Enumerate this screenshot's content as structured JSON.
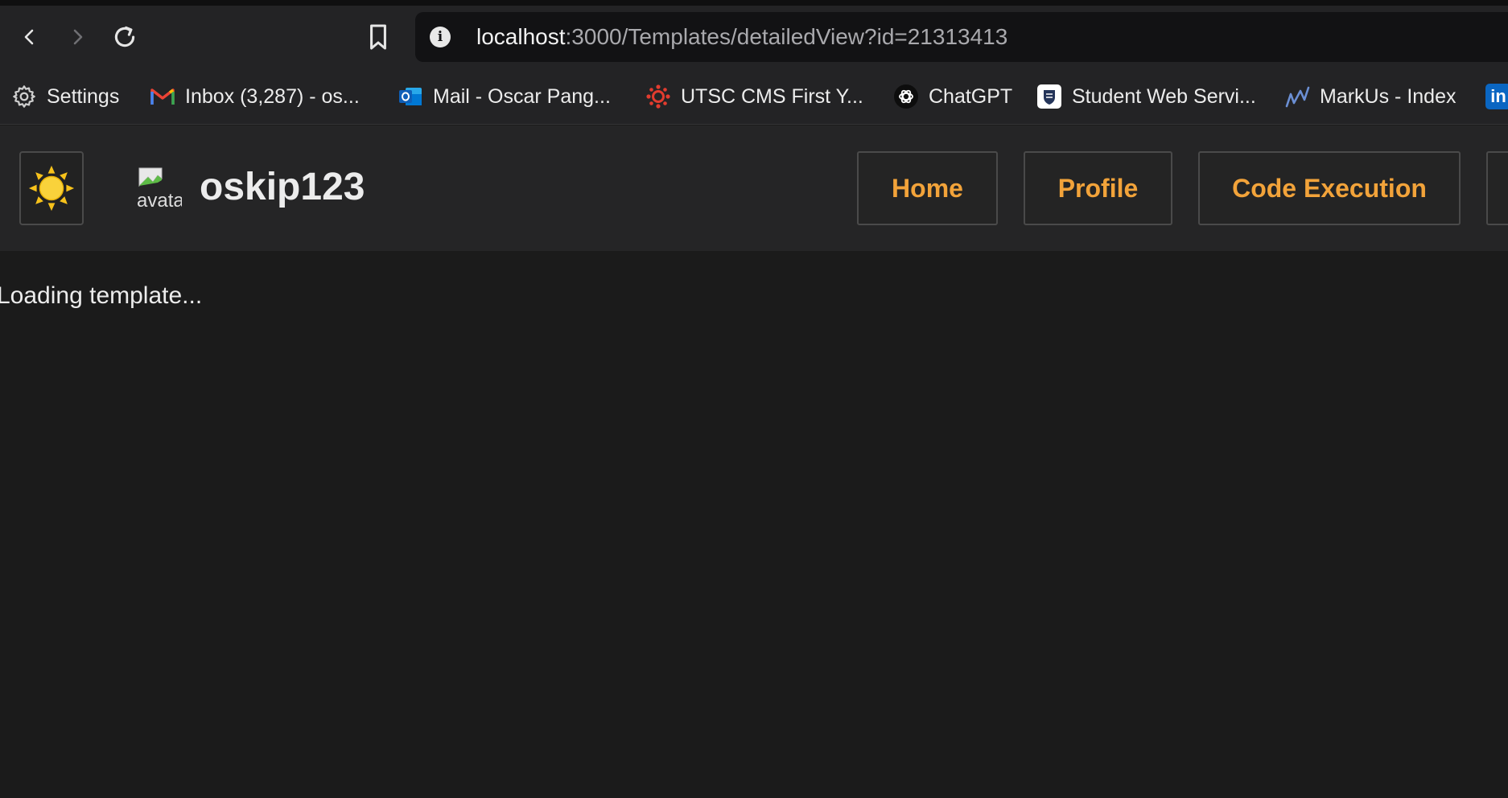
{
  "browser": {
    "url_host": "localhost",
    "url_path": ":3000/Templates/detailedView?id=21313413",
    "nav_icons": [
      "back-arrow-icon",
      "forward-arrow-icon",
      "reload-icon",
      "bookmark-icon",
      "info-icon"
    ],
    "bookmarks": [
      {
        "label": "Settings",
        "icon": "gear-icon"
      },
      {
        "label": "Inbox (3,287) - os...",
        "icon": "gmail-icon"
      },
      {
        "label": "Mail - Oscar Pang...",
        "icon": "outlook-icon"
      },
      {
        "label": "UTSC CMS First Y...",
        "icon": "canvas-icon"
      },
      {
        "label": "ChatGPT",
        "icon": "chatgpt-icon"
      },
      {
        "label": "Student Web Servi...",
        "icon": "uoft-crest-icon"
      },
      {
        "label": "MarkUs - Index",
        "icon": "markus-icon"
      },
      {
        "label": "in",
        "icon": "linkedin-icon"
      }
    ]
  },
  "header": {
    "theme_icon": "sun-icon",
    "avatar_alt": "avatar",
    "username": "oskip123",
    "nav": {
      "home": "Home",
      "profile": "Profile",
      "code_execution": "Code Execution"
    }
  },
  "main": {
    "status_text": "Loading template..."
  },
  "colors": {
    "accent": "#f2a33a",
    "page_bg": "#1b1b1b",
    "header_bg": "#252526",
    "chrome_bg": "#232325"
  }
}
